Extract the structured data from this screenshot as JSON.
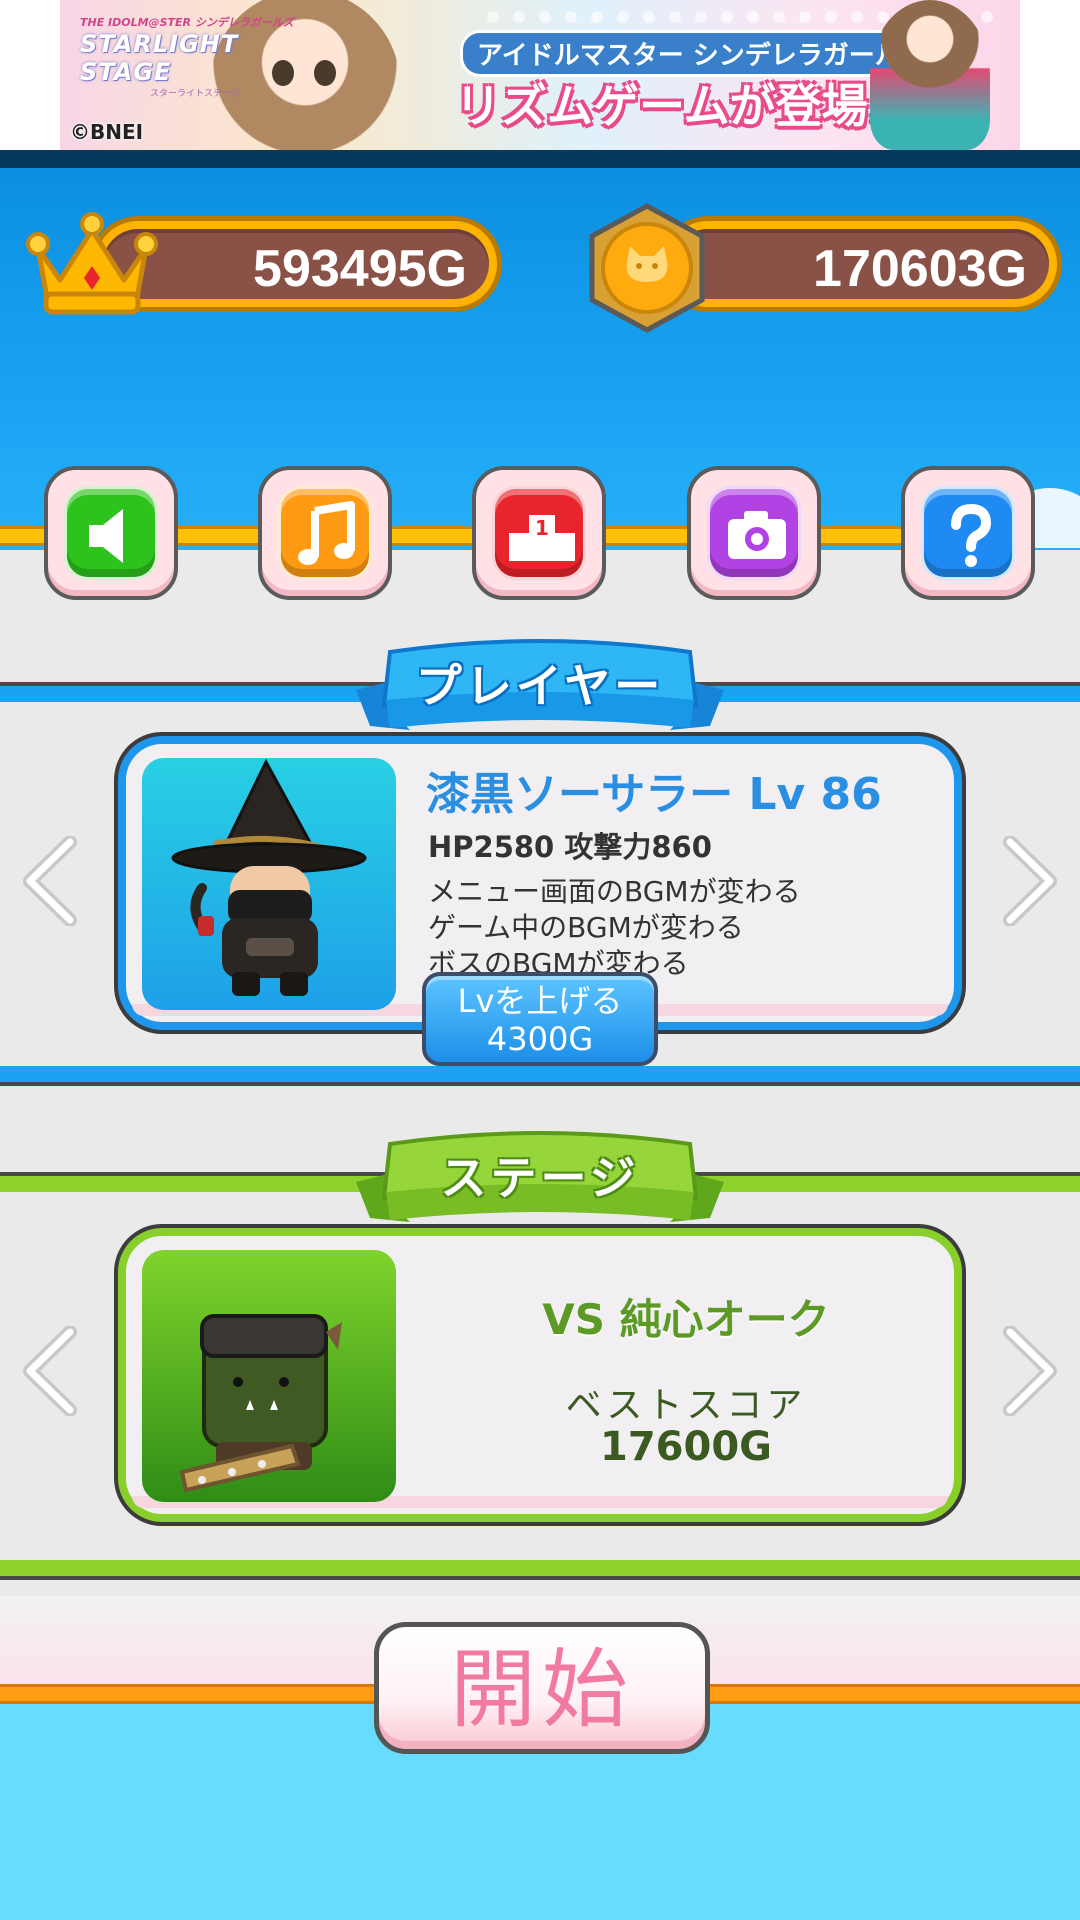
{
  "banner": {
    "logo_line1": "THE IDOLM@STER シンデレラガールズ",
    "logo_line2": "STARLIGHT STAGE",
    "logo_line3": "スターライトステージ",
    "headline": "アイドルマスター シンデレラガールズの",
    "subheadline": "リズムゲームが登場♪",
    "copyright": "©BNEI"
  },
  "currencies": {
    "crown_gold": "593495G",
    "cat_coin": "170603G"
  },
  "toolbar": {
    "buttons": [
      {
        "name": "sound",
        "icon": "speaker-icon"
      },
      {
        "name": "music",
        "icon": "music-note-icon"
      },
      {
        "name": "ranking",
        "icon": "podium-icon",
        "label": "1"
      },
      {
        "name": "camera",
        "icon": "camera-icon"
      },
      {
        "name": "help",
        "icon": "question-icon",
        "label": "?"
      }
    ]
  },
  "player": {
    "section_title": "プレイヤー",
    "name": "漆黒ソーサラー Lv 86",
    "stats": "HP2580 攻撃力860",
    "effects": [
      "メニュー画面のBGMが変わる",
      "ゲーム中のBGMが変わる",
      "ボスのBGMが変わる"
    ],
    "levelup_line1": "Lvを上げる",
    "levelup_line2": "4300G"
  },
  "stage": {
    "section_title": "ステージ",
    "name": "VS 純心オーク",
    "best_label": "ベストスコア",
    "best_value": "17600G"
  },
  "start": {
    "label": "開始"
  },
  "colors": {
    "sky_blue": "#1aa3f2",
    "player_blue": "#1e96ec",
    "stage_green": "#88cf2b",
    "gold": "#ffb300",
    "start_pink": "#f07aa0"
  }
}
